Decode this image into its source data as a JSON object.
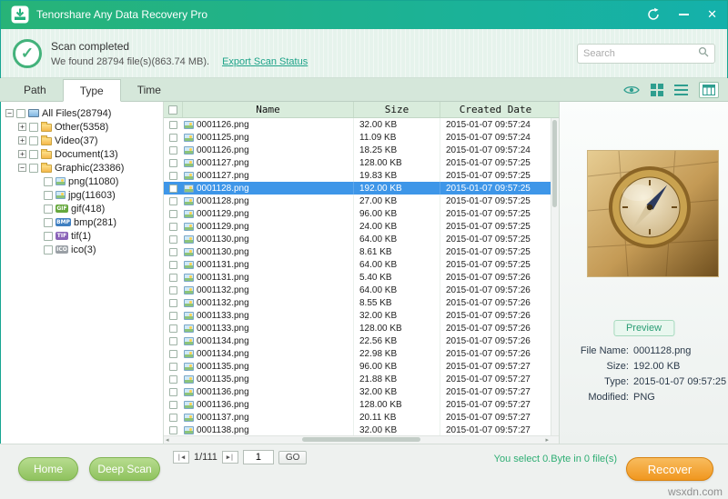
{
  "window": {
    "title": "Tenorshare Any Data Recovery Pro"
  },
  "header": {
    "status": "Scan completed",
    "summary": "We found 28794 file(s)(863.74 MB).",
    "export_link": "Export Scan Status",
    "search_placeholder": "Search"
  },
  "tabs": {
    "items": [
      {
        "label": "Path"
      },
      {
        "label": "Type",
        "active": true
      },
      {
        "label": "Time"
      }
    ]
  },
  "tree": {
    "items": [
      {
        "label": "All Files(28794)",
        "level": 0,
        "expander": "-",
        "icon": "computer"
      },
      {
        "label": "Other(5358)",
        "level": 1,
        "expander": "+",
        "icon": "folder"
      },
      {
        "label": "Video(37)",
        "level": 1,
        "expander": "+",
        "icon": "folder"
      },
      {
        "label": "Document(13)",
        "level": 1,
        "expander": "+",
        "icon": "folder"
      },
      {
        "label": "Graphic(23386)",
        "level": 1,
        "expander": "-",
        "icon": "folder"
      },
      {
        "label": "png(11080)",
        "level": 2,
        "icon": "png"
      },
      {
        "label": "jpg(11603)",
        "level": 2,
        "icon": "jpg"
      },
      {
        "label": "gif(418)",
        "level": 2,
        "icon": "gif"
      },
      {
        "label": "bmp(281)",
        "level": 2,
        "icon": "bmp"
      },
      {
        "label": "tif(1)",
        "level": 2,
        "icon": "tif"
      },
      {
        "label": "ico(3)",
        "level": 2,
        "icon": "ico"
      }
    ]
  },
  "table": {
    "columns": [
      "Name",
      "Size",
      "Created Date"
    ],
    "rows": [
      {
        "name": "0001126.png",
        "size": "32.00 KB",
        "date": "2015-01-07 09:57:24",
        "selected": false
      },
      {
        "name": "0001125.png",
        "size": "11.09 KB",
        "date": "2015-01-07 09:57:24",
        "selected": false
      },
      {
        "name": "0001126.png",
        "size": "18.25 KB",
        "date": "2015-01-07 09:57:24",
        "selected": false
      },
      {
        "name": "0001127.png",
        "size": "128.00 KB",
        "date": "2015-01-07 09:57:25",
        "selected": false
      },
      {
        "name": "0001127.png",
        "size": "19.83 KB",
        "date": "2015-01-07 09:57:25",
        "selected": false
      },
      {
        "name": "0001128.png",
        "size": "192.00 KB",
        "date": "2015-01-07 09:57:25",
        "selected": true
      },
      {
        "name": "0001128.png",
        "size": "27.00 KB",
        "date": "2015-01-07 09:57:25",
        "selected": false
      },
      {
        "name": "0001129.png",
        "size": "96.00 KB",
        "date": "2015-01-07 09:57:25",
        "selected": false
      },
      {
        "name": "0001129.png",
        "size": "24.00 KB",
        "date": "2015-01-07 09:57:25",
        "selected": false
      },
      {
        "name": "0001130.png",
        "size": "64.00 KB",
        "date": "2015-01-07 09:57:25",
        "selected": false
      },
      {
        "name": "0001130.png",
        "size": "8.61 KB",
        "date": "2015-01-07 09:57:25",
        "selected": false
      },
      {
        "name": "0001131.png",
        "size": "64.00 KB",
        "date": "2015-01-07 09:57:25",
        "selected": false
      },
      {
        "name": "0001131.png",
        "size": "5.40 KB",
        "date": "2015-01-07 09:57:26",
        "selected": false
      },
      {
        "name": "0001132.png",
        "size": "64.00 KB",
        "date": "2015-01-07 09:57:26",
        "selected": false
      },
      {
        "name": "0001132.png",
        "size": "8.55 KB",
        "date": "2015-01-07 09:57:26",
        "selected": false
      },
      {
        "name": "0001133.png",
        "size": "32.00 KB",
        "date": "2015-01-07 09:57:26",
        "selected": false
      },
      {
        "name": "0001133.png",
        "size": "128.00 KB",
        "date": "2015-01-07 09:57:26",
        "selected": false
      },
      {
        "name": "0001134.png",
        "size": "22.56 KB",
        "date": "2015-01-07 09:57:26",
        "selected": false
      },
      {
        "name": "0001134.png",
        "size": "22.98 KB",
        "date": "2015-01-07 09:57:26",
        "selected": false
      },
      {
        "name": "0001135.png",
        "size": "96.00 KB",
        "date": "2015-01-07 09:57:27",
        "selected": false
      },
      {
        "name": "0001135.png",
        "size": "21.88 KB",
        "date": "2015-01-07 09:57:27",
        "selected": false
      },
      {
        "name": "0001136.png",
        "size": "32.00 KB",
        "date": "2015-01-07 09:57:27",
        "selected": false
      },
      {
        "name": "0001136.png",
        "size": "128.00 KB",
        "date": "2015-01-07 09:57:27",
        "selected": false
      },
      {
        "name": "0001137.png",
        "size": "20.11 KB",
        "date": "2015-01-07 09:57:27",
        "selected": false
      },
      {
        "name": "0001138.png",
        "size": "32.00 KB",
        "date": "2015-01-07 09:57:27",
        "selected": false
      }
    ]
  },
  "pagination": {
    "page": "1/111",
    "input": "1",
    "go": "GO",
    "prev": "|◀",
    "next": "▶|"
  },
  "preview": {
    "button": "Preview",
    "fields": [
      {
        "label": "File Name:",
        "value": "0001128.png"
      },
      {
        "label": "Size:",
        "value": "192.00 KB"
      },
      {
        "label": "Type:",
        "value": "2015-01-07 09:57:25"
      },
      {
        "label": "Modified:",
        "value": "PNG"
      }
    ]
  },
  "footer": {
    "home": "Home",
    "deep_scan": "Deep Scan",
    "selection": "You select 0.Byte in 0 file(s)",
    "recover": "Recover"
  },
  "watermark": "wsxdn.com",
  "colors": {
    "titlebar_left": "#27b377",
    "titlebar_right": "#14b1ab",
    "accent_teal": "#2e9e8f",
    "selected_row": "#3e96e8",
    "green_button": "#8fc25e",
    "recover_orange": "#f0971f",
    "selection_text": "#2fae74"
  }
}
